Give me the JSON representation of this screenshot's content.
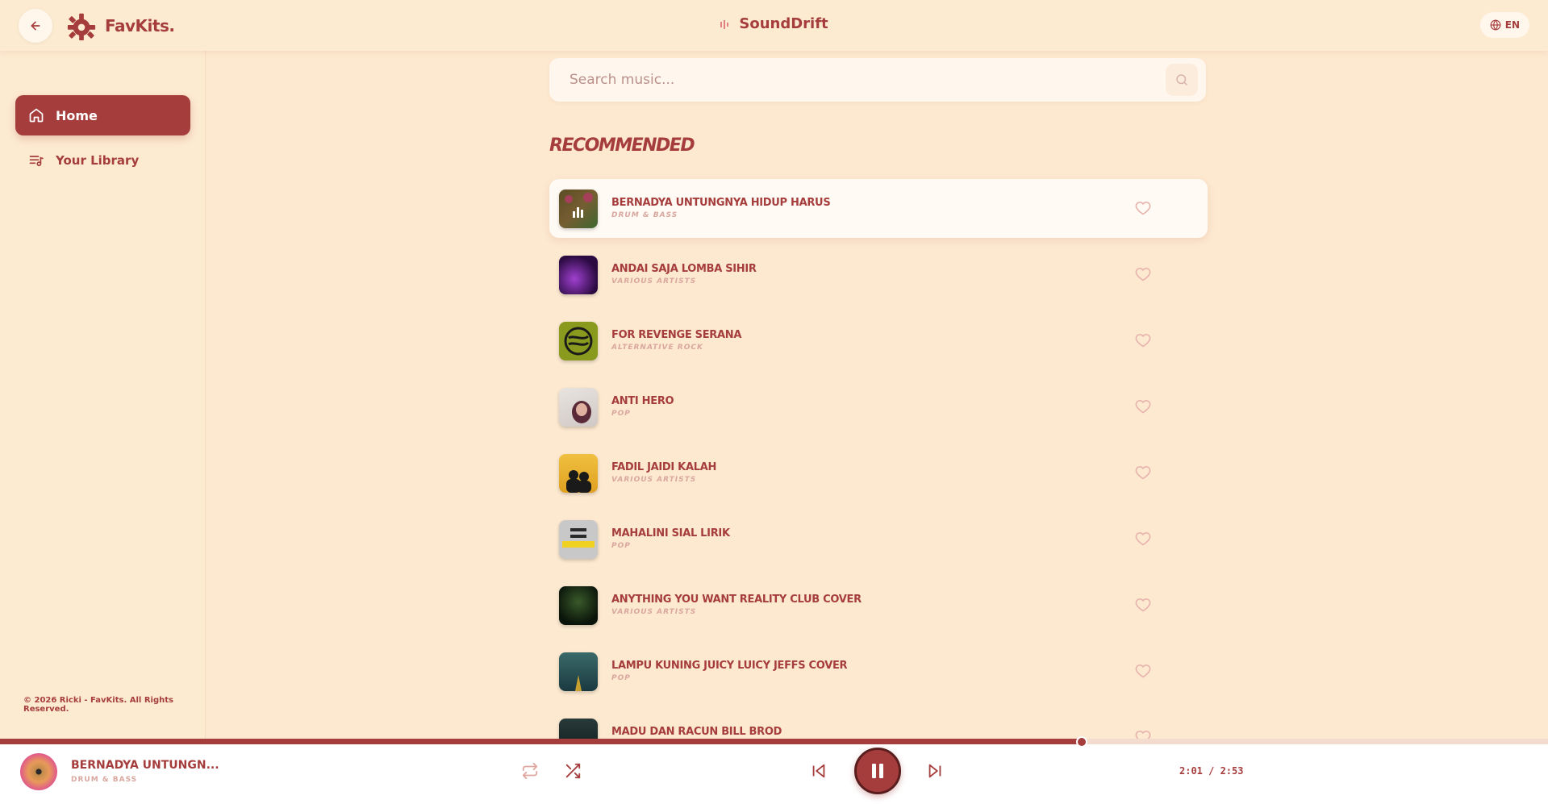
{
  "header": {
    "logo_text": "FavKits.",
    "app_title": "SoundDrift",
    "lang_label": "EN"
  },
  "sidebar": {
    "items": [
      {
        "label": "Home",
        "active": true,
        "icon": "home-icon"
      },
      {
        "label": "Your Library",
        "active": false,
        "icon": "library-icon"
      }
    ],
    "copyright": "© 2026 Ricki - FavKits. All Rights Reserved."
  },
  "search": {
    "placeholder": "Search music..."
  },
  "section_title": "RECOMMENDED",
  "tracks": [
    {
      "title": "BERNADYA UNTUNGNYA HIDUP HARUS",
      "subtitle": "DRUM & BASS"
    },
    {
      "title": "ANDAI SAJA LOMBA SIHIR",
      "subtitle": "VARIOUS ARTISTS"
    },
    {
      "title": "FOR REVENGE SERANA",
      "subtitle": "ALTERNATIVE ROCK"
    },
    {
      "title": "ANTI HERO",
      "subtitle": "POP"
    },
    {
      "title": "FADIL JAIDI KALAH",
      "subtitle": "VARIOUS ARTISTS"
    },
    {
      "title": "MAHALINI SIAL LIRIK",
      "subtitle": "POP"
    },
    {
      "title": "ANYTHING YOU WANT REALITY CLUB COVER",
      "subtitle": "VARIOUS ARTISTS"
    },
    {
      "title": "LAMPU KUNING JUICY LUICY JEFFS COVER",
      "subtitle": "POP"
    },
    {
      "title": "MADU DAN RACUN BILL BROD",
      "subtitle": ""
    }
  ],
  "player": {
    "title": "BERNADYA UNTUNGN...",
    "subtitle": "DRUM & BASS",
    "time": "2:01 / 2:53",
    "progress": 0.699
  },
  "colors": {
    "accent": "#a63d3d",
    "background": "#fde9d0"
  }
}
